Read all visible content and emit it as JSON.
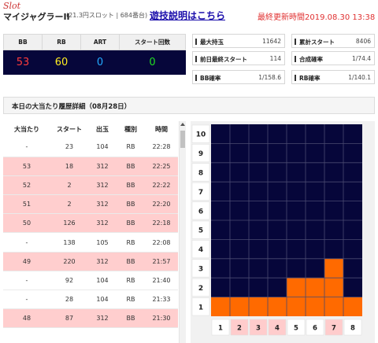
{
  "header": {
    "logo_script": "Slot",
    "machine_name": "マイジャグラーII",
    "machine_info": "(21.3円スロット | 684番台)",
    "manual_link": "遊技説明はこちら",
    "updated_label": "最終更新時間",
    "updated_value": "2019.08.30 13:38"
  },
  "counters": {
    "headers": [
      "BB",
      "RB",
      "ART",
      "スタート回数"
    ],
    "bb": "53",
    "rb": "60",
    "art": "0",
    "start": "0",
    "colors": {
      "bb": "#ff3b3b",
      "rb": "#ffee22",
      "art": "#22aaff",
      "start": "#22dd22",
      "panel": "#06063a"
    }
  },
  "stats": [
    {
      "label": "最大持玉",
      "value": "11642"
    },
    {
      "label": "累計スタート",
      "value": "8406"
    },
    {
      "label": "前日最終スタート",
      "value": "114"
    },
    {
      "label": "合成確率",
      "value": "1/74.4"
    },
    {
      "label": "BB確率",
      "value": "1/158.6"
    },
    {
      "label": "RB確率",
      "value": "1/140.1"
    }
  ],
  "history": {
    "title": "本日の大当たり履歴詳細（08月28日）",
    "columns": [
      "大当たり",
      "スタート",
      "出玉",
      "種別",
      "時間"
    ],
    "rows": [
      {
        "no": "-",
        "start": "23",
        "out": "104",
        "type": "RB",
        "time": "22:28",
        "hit": false
      },
      {
        "no": "53",
        "start": "18",
        "out": "312",
        "type": "BB",
        "time": "22:25",
        "hit": true
      },
      {
        "no": "52",
        "start": "2",
        "out": "312",
        "type": "BB",
        "time": "22:22",
        "hit": true
      },
      {
        "no": "51",
        "start": "2",
        "out": "312",
        "type": "BB",
        "time": "22:20",
        "hit": true
      },
      {
        "no": "50",
        "start": "126",
        "out": "312",
        "type": "BB",
        "time": "22:18",
        "hit": true
      },
      {
        "no": "-",
        "start": "138",
        "out": "105",
        "type": "RB",
        "time": "22:08",
        "hit": false
      },
      {
        "no": "49",
        "start": "220",
        "out": "312",
        "type": "BB",
        "time": "21:57",
        "hit": true
      },
      {
        "no": "-",
        "start": "92",
        "out": "104",
        "type": "RB",
        "time": "21:40",
        "hit": false
      },
      {
        "no": "-",
        "start": "28",
        "out": "104",
        "type": "RB",
        "time": "21:33",
        "hit": false
      },
      {
        "no": "48",
        "start": "87",
        "out": "312",
        "type": "BB",
        "time": "21:30",
        "hit": true
      }
    ]
  },
  "chart_data": {
    "type": "bar",
    "categories": [
      "1",
      "2",
      "3",
      "4",
      "5",
      "6",
      "7",
      "8"
    ],
    "values": [
      1,
      1,
      1,
      1,
      2,
      2,
      3,
      1
    ],
    "y_ticks": [
      "1",
      "2",
      "3",
      "4",
      "5",
      "6",
      "7",
      "8",
      "9",
      "10"
    ],
    "ylim": [
      0,
      10
    ],
    "grid": true,
    "highlighted_categories": [
      "2",
      "3",
      "4",
      "7"
    ],
    "colors": {
      "bar": "#ff6a00",
      "background": "#06063a",
      "grid": "#4a4a70",
      "tick_highlight": "#ffcccc"
    }
  }
}
